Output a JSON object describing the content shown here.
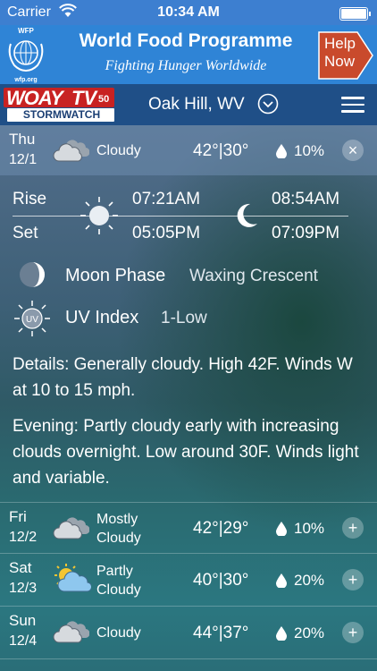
{
  "status_bar": {
    "carrier": "Carrier",
    "time": "10:34 AM"
  },
  "ad": {
    "logo_top": "WFP",
    "logo_bottom": "wfp.org",
    "title": "World Food Programme",
    "tagline": "Fighting Hunger Worldwide",
    "button_line1": "Help",
    "button_line2": "Now",
    "colors": {
      "background": "#2f84d6",
      "button": "#c94a2c"
    }
  },
  "header": {
    "station_name": "WOAY",
    "station_tv": "TV",
    "station_channel": "50",
    "station_sub": "STORMWATCH",
    "location": "Oak Hill, WV",
    "colors": {
      "background": "#1f4f87"
    }
  },
  "days": [
    {
      "day": "Thu",
      "date": "12/1",
      "condition": "Cloudy",
      "high": "42°",
      "low": "30°",
      "precip": "10%",
      "icon": "cloud-icon",
      "action": "×"
    },
    {
      "day": "Fri",
      "date": "12/2",
      "condition_line1": "Mostly",
      "condition_line2": "Cloudy",
      "high": "42°",
      "low": "29°",
      "precip": "10%",
      "icon": "cloud-icon",
      "action": "+"
    },
    {
      "day": "Sat",
      "date": "12/3",
      "condition_line1": "Partly",
      "condition_line2": "Cloudy",
      "high": "40°",
      "low": "30°",
      "precip": "20%",
      "icon": "partly-cloudy-icon",
      "action": "+"
    },
    {
      "day": "Sun",
      "date": "12/4",
      "condition": "Cloudy",
      "high": "44°",
      "low": "37°",
      "precip": "20%",
      "icon": "cloud-icon",
      "action": "+"
    }
  ],
  "temp_separator": "|",
  "detail": {
    "rise_label": "Rise",
    "set_label": "Set",
    "sunrise": "07:21AM",
    "sunset": "05:05PM",
    "moonrise": "08:54AM",
    "moonset": "07:09PM",
    "moon_phase_label": "Moon Phase",
    "moon_phase_value": "Waxing Crescent",
    "uv_label": "UV Index",
    "uv_value": "1-Low",
    "uv_badge": "UV",
    "details_text": "Details: Generally cloudy. High 42F. Winds W at 10 to 15 mph.",
    "evening_text": "Evening: Partly cloudy early with increasing clouds overnight. Low around 30F. Winds light and variable."
  }
}
